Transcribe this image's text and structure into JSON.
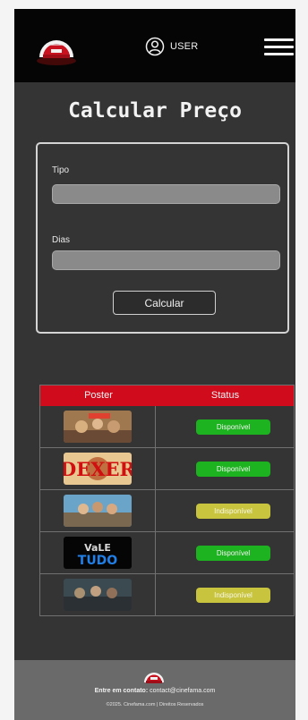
{
  "header": {
    "user_label": "USER"
  },
  "page": {
    "title": "Calcular Preço"
  },
  "form": {
    "tipo_label": "Tipo",
    "tipo_value": "",
    "dias_label": "Dias",
    "dias_value": "",
    "calc_label": "Calcular"
  },
  "table": {
    "headers": [
      "Poster",
      "Status"
    ],
    "rows": [
      {
        "poster": "movie-poster-1",
        "status": "Disponível",
        "state": "available"
      },
      {
        "poster": "movie-poster-dexter",
        "status": "Disponível",
        "state": "available"
      },
      {
        "poster": "movie-poster-3",
        "status": "Indisponível",
        "state": "unavailable"
      },
      {
        "poster": "movie-poster-vale-tudo",
        "status": "Disponível",
        "state": "available"
      },
      {
        "poster": "movie-poster-5",
        "status": "Indisponível",
        "state": "unavailable"
      }
    ]
  },
  "footer": {
    "contact_label": "Entre em contato:",
    "contact_email": "contact@cinefama.com",
    "copyright": "©2025. Cinefama.com | Direitos Reservados"
  },
  "colors": {
    "accent": "#d00b1c",
    "available": "#1db21f",
    "unavailable": "#c8c43e",
    "background": "#343434"
  }
}
